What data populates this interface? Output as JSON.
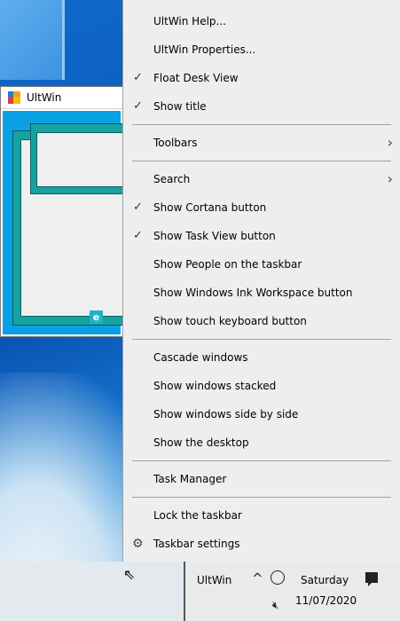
{
  "preview": {
    "title": "UltWin",
    "edge_glyph": "e"
  },
  "menu": {
    "items": [
      {
        "label": "UltWin Help...",
        "check": ""
      },
      {
        "label": "UltWin Properties...",
        "check": ""
      },
      {
        "label": "Float Desk View",
        "check": "✓"
      },
      {
        "label": "Show title",
        "check": "✓"
      },
      {
        "label": "Toolbars",
        "arrow": "›"
      },
      {
        "label": "Search",
        "arrow": "›"
      },
      {
        "label": "Show Cortana button",
        "check": "✓"
      },
      {
        "label": "Show Task View button",
        "check": "✓"
      },
      {
        "label": "Show People on the taskbar",
        "check": ""
      },
      {
        "label": "Show Windows Ink Workspace button",
        "check": ""
      },
      {
        "label": "Show touch keyboard button",
        "check": ""
      },
      {
        "label": "Cascade windows",
        "check": ""
      },
      {
        "label": "Show windows stacked",
        "check": ""
      },
      {
        "label": "Show windows side by side",
        "check": ""
      },
      {
        "label": "Show the desktop",
        "check": ""
      },
      {
        "label": "Task Manager",
        "check": ""
      },
      {
        "label": "Lock the taskbar",
        "check": ""
      },
      {
        "label": "Taskbar settings",
        "icon": "gear-icon",
        "glyph": "⚙"
      }
    ]
  },
  "taskbar": {
    "app_label": "UltWin",
    "chevron": "^",
    "speaker_glyph": "🔇︎",
    "day": "Saturday",
    "date": "11/07/2020"
  },
  "colors": {
    "accent": "#0078d7",
    "preview_bg": "#0aa0e6",
    "window_teal": "#17a2a2"
  }
}
